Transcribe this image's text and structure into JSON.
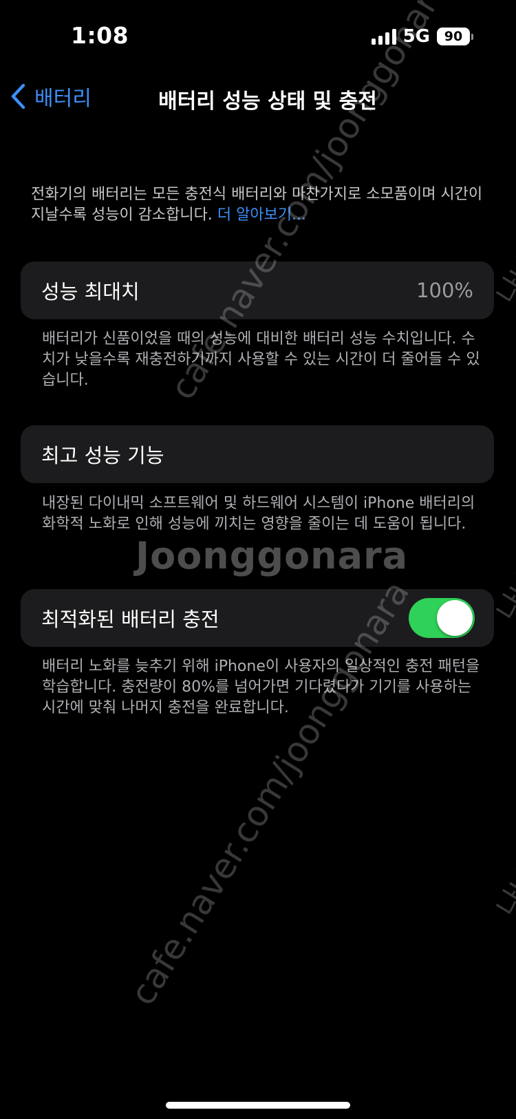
{
  "status_bar": {
    "time": "1:08",
    "network": "5G",
    "battery_level": "90",
    "signal_icon": "cellular-signal-icon",
    "battery_icon": "battery-icon"
  },
  "nav": {
    "back_label": "배터리",
    "back_icon": "chevron-left-icon",
    "title": "배터리 성능 상태 및 충전"
  },
  "intro": {
    "text": "전화기의 배터리는 모든 충전식 배터리와 마찬가지로 소모품이며 시간이 지날수록 성능이 감소합니다. ",
    "link": "더 알아보기..."
  },
  "max_capacity": {
    "label": "성능 최대치",
    "value": "100%",
    "footnote": "배터리가 신품이었을 때의 성능에 대비한 배터리 성능 수치입니다. 수치가 낮을수록 재충전하기까지 사용할 수 있는 시간이 더 줄어들 수 있습니다."
  },
  "peak_performance": {
    "label": "최고 성능 기능",
    "footnote": "내장된 다이내믹 소프트웨어 및 하드웨어 시스템이 iPhone 배터리의 화학적 노화로 인해 성능에 끼치는 영향을 줄이는 데 도움이 됩니다."
  },
  "optimized_charging": {
    "label": "최적화된 배터리 충전",
    "enabled": true,
    "footnote": "배터리 노화를 늦추기 위해 iPhone이 사용자의 일상적인 충전 패턴을 학습합니다. 충전량이 80%를 넘어가면 기다렸다가 기기를 사용하는 시간에 맞춰 나머지 충전을 완료합니다."
  },
  "watermark": {
    "brand": "Joonggonara",
    "url": "cafe.naver.com/joonggonara",
    "side": "나나"
  },
  "colors": {
    "accent": "#3e8ef7",
    "toggle_on": "#30d158",
    "card_bg": "#1c1c1e",
    "background": "#000000"
  }
}
